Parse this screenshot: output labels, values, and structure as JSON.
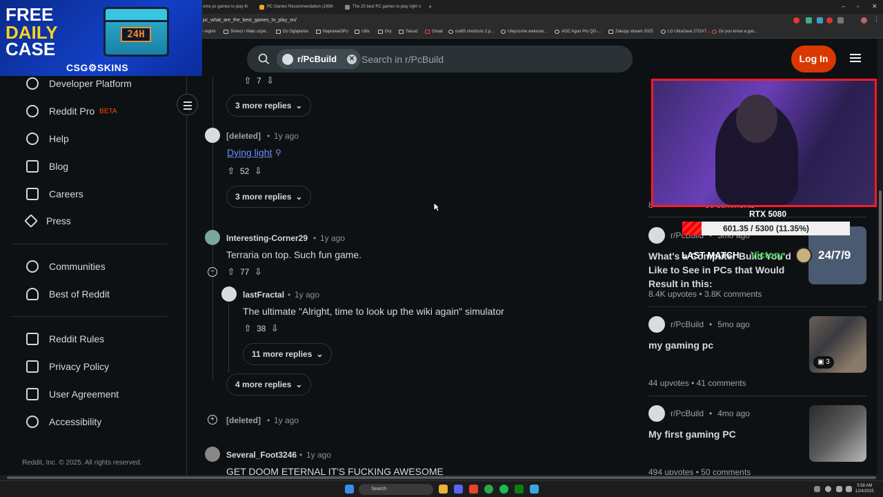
{
  "browser": {
    "tabs": [
      {
        "label": "ome pc games to play th"
      },
      {
        "label": "PC Games Recommendation (1998-"
      },
      {
        "label": "The 25 best PC games to play right n"
      }
    ],
    "new_tab": "+",
    "url": "pc_what_are_the_best_games_to_play_on/",
    "bookmarks": [
      {
        "label": "i legimi"
      },
      {
        "label": "Śmieci / Mało używ..."
      },
      {
        "label": "Do Oglądania"
      },
      {
        "label": "NaprawaGPU"
      },
      {
        "label": "Utils"
      },
      {
        "label": "Gry"
      },
      {
        "label": "Tatuaż"
      },
      {
        "label": "Gmail"
      },
      {
        "label": "nut65 shortcuts 2.p..."
      },
      {
        "label": "Ulepszone welurow..."
      },
      {
        "label": "AOC Agon Pro QD-..."
      },
      {
        "label": "Zakupy stream 2025"
      },
      {
        "label": "LG UltraGear 27GX7..."
      },
      {
        "label": "Do you know a goo..."
      }
    ]
  },
  "overlay_logo": {
    "line1": "FREE",
    "line2": "DAILY",
    "line3": "CASE",
    "badge": "24H",
    "brand": "CSG⚙SKINS"
  },
  "header": {
    "subreddit_chip": "r/PcBuild",
    "search_placeholder": "Search in r/PcBuild",
    "login_label": "Log In"
  },
  "sidebar": {
    "items": [
      {
        "label": "Developer Platform"
      },
      {
        "label": "Reddit Pro"
      },
      {
        "label": "Help"
      },
      {
        "label": "Blog"
      },
      {
        "label": "Careers"
      },
      {
        "label": "Press"
      },
      {
        "label": "Communities"
      },
      {
        "label": "Best of Reddit"
      },
      {
        "label": "Reddit Rules"
      },
      {
        "label": "Privacy Policy"
      },
      {
        "label": "User Agreement"
      },
      {
        "label": "Accessibility"
      }
    ],
    "beta_badge": "BETA",
    "copyright": "Reddit, Inc. © 2025. All rights reserved."
  },
  "comments": {
    "top_votes": "7",
    "more1": "3 more replies",
    "c1": {
      "user": "[deleted]",
      "time": "1y ago",
      "text": "Dying light",
      "votes": "52"
    },
    "more2": "3 more replies",
    "c2": {
      "user": "Interesting-Corner29",
      "time": "1y ago",
      "text": "Terraria on top. Such fun game.",
      "votes": "77"
    },
    "c3": {
      "user": "lastFractal",
      "time": "1y ago",
      "text": "The ultimate \"Alright, time to look up the wiki again\" simulator",
      "votes": "38"
    },
    "more3": "11 more replies",
    "more4": "4 more replies",
    "c4": {
      "user": "[deleted]",
      "time": "1y ago"
    },
    "c5": {
      "user": "Several_Foot3246",
      "time": "1y ago",
      "text": "GET DOOM ETERNAL IT'S FUCKING AWESOME"
    },
    "dot": "•"
  },
  "right_posts": [
    {
      "sub": "r/PcBuild",
      "age": "5mo ago",
      "title": "What's a Computer Build You'd Like to See in PCs that Would Result in this:",
      "upvotes": "8.4K upvotes",
      "comments": "3.8K comments"
    },
    {
      "sub": "r/PcBuild",
      "age": "5mo ago",
      "title": "my gaming pc",
      "upvotes": "44 upvotes",
      "comments": "41 comments",
      "thumb_badge": "3"
    },
    {
      "sub": "r/PcBuild",
      "age": "4mo ago",
      "title": "My first gaming PC",
      "upvotes": "494 upvotes",
      "comments": "50 comments"
    }
  ],
  "right_partial": {
    "stats_tail": "8",
    "stats_comments": "50 comments"
  },
  "stream_overlay": {
    "gpu_name": "RTX 5080",
    "gpu_progress_text": "601.35 / 5300 (11.35%)",
    "gpu_progress": 0.1135,
    "last_match": "LAST MATCH",
    "result": "Victory",
    "badge": "24/7/9"
  },
  "taskbar": {
    "search": "Search",
    "time": "5:58 AM",
    "date": "12/4/2025"
  },
  "colors": {
    "accent": "#ff4500",
    "login": "#d93900",
    "link": "#6b8cff",
    "victory": "#3cd04a",
    "webcam_border": "#ff1a2a"
  }
}
